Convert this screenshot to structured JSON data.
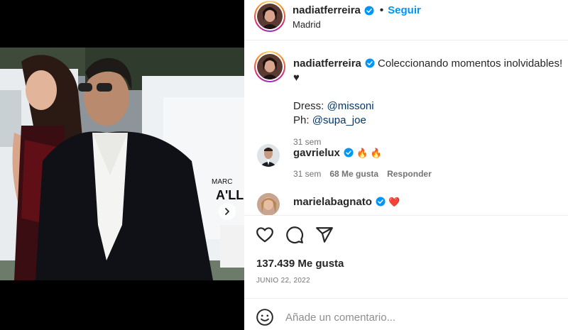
{
  "post": {
    "username": "nadiatferreira",
    "follow_label": "Seguir",
    "separator": "•",
    "location": "Madrid",
    "caption_text": "Coleccionando momentos inolvidables! ♥",
    "caption_dress_label": "Dress:",
    "caption_dress_mention": "@missoni",
    "caption_ph_label": "Ph:",
    "caption_ph_mention": "@supa_joe",
    "caption_time": "31 sem"
  },
  "carousel": {
    "dot_count": 5,
    "active_index": 0
  },
  "comments": [
    {
      "username": "gavrielux",
      "text": "🔥 🔥",
      "time": "31 sem",
      "likes": "68 Me gusta",
      "reply_label": "Responder"
    },
    {
      "username": "marielabagnato",
      "text": "❤️"
    }
  ],
  "likes_count": "137.439 Me gusta",
  "date": "JUNIO 22, 2022",
  "add_comment_placeholder": "Añade un comentario...",
  "icons": {
    "like": "heart-icon",
    "comment": "comment-icon",
    "share": "share-icon",
    "emoji": "emoji-icon",
    "next": "chevron-right-icon",
    "verified": "verified-badge-icon"
  },
  "colors": {
    "link": "#0095f6",
    "mention": "#00376b",
    "muted": "#737373",
    "verified": "#0095f6",
    "heart": "#ed4956"
  }
}
